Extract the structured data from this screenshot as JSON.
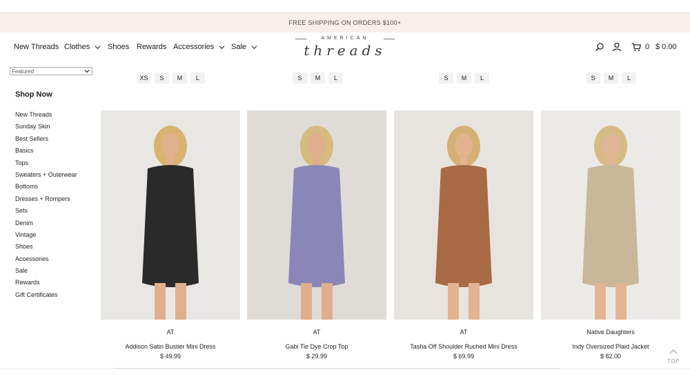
{
  "promo": {
    "text": "FREE SHIPPING ON ORDERS $100+"
  },
  "nav": {
    "items": [
      {
        "label": "New Threads",
        "has_dropdown": false
      },
      {
        "label": "Clothes",
        "has_dropdown": true
      },
      {
        "label": "Shoes",
        "has_dropdown": false
      },
      {
        "label": "Rewards",
        "has_dropdown": false
      },
      {
        "label": "Accessories",
        "has_dropdown": true
      },
      {
        "label": "Sale",
        "has_dropdown": true
      }
    ]
  },
  "logo": {
    "top": "AMERICAN",
    "script": "threads"
  },
  "header": {
    "icons": [
      "search-icon",
      "account-icon",
      "cart-icon"
    ],
    "cart_count": "0",
    "cart_total": "$ 0.00"
  },
  "sort": {
    "selected": "Featured"
  },
  "sidebar": {
    "heading": "Shop Now",
    "categories": [
      "New Threads",
      "Sunday Skin",
      "Best Sellers",
      "Basics",
      "Tops",
      "Sweaters + Outerwear",
      "Bottoms",
      "Dresses + Rompers",
      "Sets",
      "Denim",
      "Vintage",
      "Shoes",
      "Accessories",
      "Sale",
      "Rewards",
      "Gift Certificates"
    ]
  },
  "products": [
    {
      "sizes": [
        "XS",
        "S",
        "M",
        "L"
      ],
      "brand": "AT",
      "name": "Addison Satin Bustier Mini Dress",
      "price": "$ 49.99",
      "garment_color": "#2b2a2a",
      "bg_color": "#e9e7e4",
      "hair_color": "#d8b36f",
      "skin_color": "#e0b08e"
    },
    {
      "sizes": [
        "S",
        "M",
        "L"
      ],
      "brand": "AT",
      "name": "Gabi Tie Dye Crop Top",
      "price": "$ 29.99",
      "garment_color": "#8a86b8",
      "bg_color": "#dfdcd7",
      "hair_color": "#d6ba7e",
      "skin_color": "#dfae8c"
    },
    {
      "sizes": [
        "S",
        "M",
        "L"
      ],
      "brand": "AT",
      "name": "Tasha Off Shoulder Ruched Mini Dress",
      "price": "$ 69.99",
      "garment_color": "#a86a44",
      "bg_color": "#e7e4df",
      "hair_color": "#d4b075",
      "skin_color": "#e3b391"
    },
    {
      "sizes": [
        "S",
        "M",
        "L"
      ],
      "brand": "Native Daughters",
      "name": "Indy Oversized Plaid Jacket",
      "price": "$ 82.00",
      "garment_color": "#c9b79a",
      "bg_color": "#eceae6",
      "hair_color": "#d7bb84",
      "skin_color": "#e2b597"
    }
  ],
  "to_top": {
    "label": "TOP"
  }
}
